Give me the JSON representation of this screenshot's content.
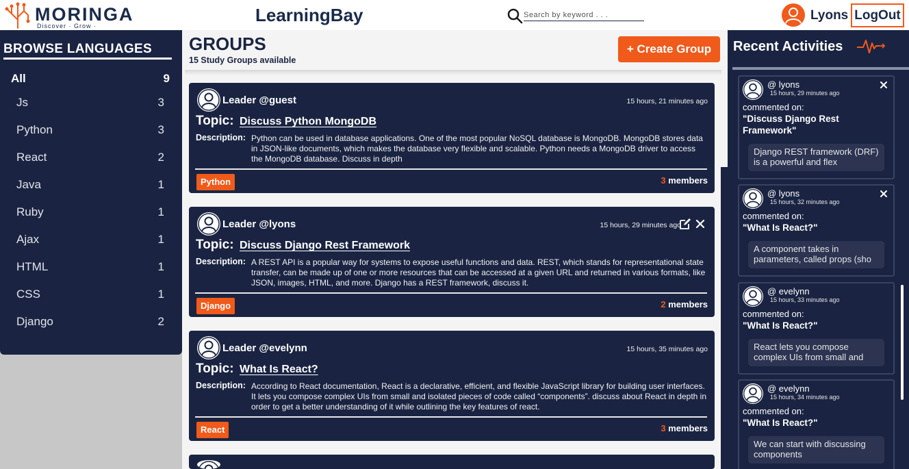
{
  "brand": {
    "name": "MORINGA",
    "tagline": "Discover · Grow · Transform"
  },
  "header": {
    "app_title": "LearningBay",
    "search_placeholder": "Search by keyword . . .",
    "user_name": "Lyons",
    "logout_label": "LogOut"
  },
  "sidebar": {
    "title": "BROWSE LANGUAGES",
    "items": [
      {
        "label": "All",
        "count": "9"
      },
      {
        "label": "Js",
        "count": "3"
      },
      {
        "label": "Python",
        "count": "3"
      },
      {
        "label": "React",
        "count": "2"
      },
      {
        "label": "Java",
        "count": "1"
      },
      {
        "label": "Ruby",
        "count": "1"
      },
      {
        "label": "Ajax",
        "count": "1"
      },
      {
        "label": "HTML",
        "count": "1"
      },
      {
        "label": "CSS",
        "count": "1"
      },
      {
        "label": "Django",
        "count": "2"
      }
    ]
  },
  "main": {
    "title": "GROUPS",
    "subtitle": "15 Study Groups available",
    "create_label": "+ Create Group",
    "topic_label": "Topic:",
    "desc_label": "Description:",
    "members_label": "members",
    "cards": [
      {
        "leader": "Leader @guest",
        "time": "15 hours, 21 minutes ago",
        "topic": "Discuss Python MongoDB",
        "description": "Python can be used in database applications. One of the most popular NoSQL database is MongoDB. MongoDB stores data in JSON-like documents, which makes the database very flexible and scalable. Python needs a MongoDB driver to access the MongoDB database. Discuss in depth",
        "tag": "Python",
        "members": "3"
      },
      {
        "leader": "Leader @lyons",
        "time": "15 hours, 29 minutes ago",
        "topic": "Discuss Django Rest Framework",
        "description": "A REST API is a popular way for systems to expose useful functions and data. REST, which stands for representational state transfer, can be made up of one or more resources that can be accessed at a given URL and returned in various formats, like JSON, images, HTML, and more. Django has a REST framework, discuss it.",
        "tag": "Django",
        "members": "2"
      },
      {
        "leader": "Leader @evelynn",
        "time": "15 hours, 35 minutes ago",
        "topic": "What Is React?",
        "description": "According to React documentation, React is a declarative, efficient, and flexible JavaScript library for building user interfaces. It lets you compose complex UIs from small and isolated pieces of code called “components”. discuss about React in depth in order to get a better understanding of it while outlining the key features of react.",
        "tag": "React",
        "members": "3"
      }
    ]
  },
  "activity": {
    "title": "Recent Activities",
    "commented_label": "commented on:",
    "items": [
      {
        "user": "@ lyons",
        "time": "15 hours, 29 minutes ago",
        "topic": "\"Discuss Django Rest Framework\"",
        "snippet": "Django REST framework (DRF) is a powerful and flex"
      },
      {
        "user": "@ lyons",
        "time": "15 hours, 32 minutes ago",
        "topic": "\"What Is React?\"",
        "snippet": "A component takes in parameters, called props (sho"
      },
      {
        "user": "@ evelynn",
        "time": "15 hours, 33 minutes ago",
        "topic": "\"What Is React?\"",
        "snippet": "React lets you compose complex UIs from small and"
      },
      {
        "user": "@ evelynn",
        "time": "15 hours, 34 minutes ago",
        "topic": "\"What Is React?\"",
        "snippet": "We can start with discussing components"
      }
    ]
  },
  "colors": {
    "navy": "#1a2442",
    "accent": "#f05a1a",
    "panel": "#f4f4f4"
  }
}
